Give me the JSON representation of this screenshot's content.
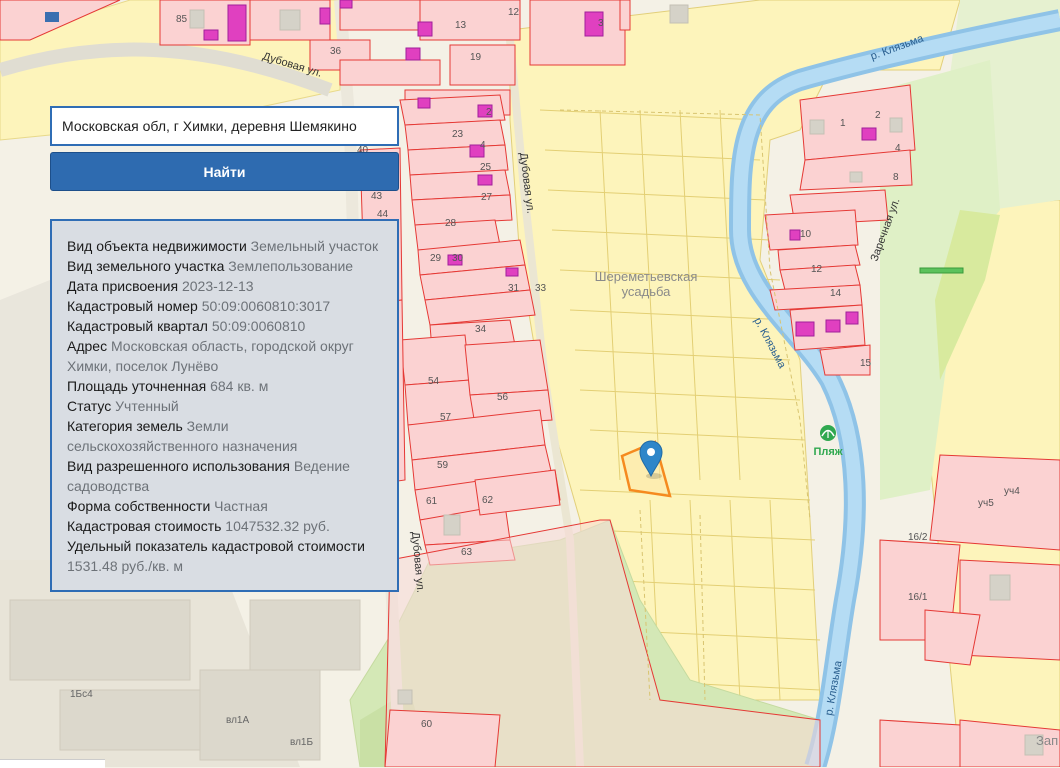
{
  "search": {
    "query": "Московская обл, г Химки, деревня Шемякино",
    "button_label": "Найти"
  },
  "info": {
    "rows": [
      {
        "key": "Вид объекта недвижимости",
        "value": "Земельный участок"
      },
      {
        "key": "Вид земельного участка",
        "value": "Землепользование"
      },
      {
        "key": "Дата присвоения",
        "value": "2023-12-13"
      },
      {
        "key": "Кадастровый номер",
        "value": "50:09:0060810:3017"
      },
      {
        "key": "Кадастровый квартал",
        "value": "50:09:0060810"
      },
      {
        "key": "Адрес",
        "value": "Московская область, городской округ Химки, поселок Лунёво"
      },
      {
        "key": "Площадь уточненная",
        "value": "684 кв. м"
      },
      {
        "key": "Статус",
        "value": "Учтенный"
      },
      {
        "key": "Категория земель",
        "value": "Земли сельскохозяйственного назначения"
      },
      {
        "key": "Вид разрешенного использования",
        "value": "Ведение садоводства"
      },
      {
        "key": "Форма собственности",
        "value": "Частная"
      },
      {
        "key": "Кадастровая стоимость",
        "value": "1047532.32 руб."
      },
      {
        "key": "Удельный показатель кадастровой стоимости",
        "value": "1531.48 руб./кв. м"
      }
    ]
  },
  "map": {
    "streets": {
      "dubovaya_top": "Дубовая ул.",
      "dubovaya_mid": "Дубовая ул.",
      "dubovaya_bottom": "Дубовая ул.",
      "zarechnaya": "Заречная ул."
    },
    "rivers": {
      "top": "р. Клязьма",
      "mid": "р. Клязьма",
      "bottom": "р. Клязьма"
    },
    "area_label_1": "Шереметьевская",
    "area_label_2": "усадьба",
    "beach_label": "Пляж",
    "house_numbers": [
      "85",
      "13",
      "12",
      "3",
      "36",
      "19",
      "2",
      "23",
      "4",
      "40",
      "25",
      "43",
      "27",
      "44",
      "28",
      "29",
      "30",
      "31",
      "33",
      "34",
      "54",
      "56",
      "57",
      "59",
      "61",
      "62",
      "63",
      "60",
      "2",
      "1",
      "4",
      "8",
      "10",
      "12",
      "14",
      "15",
      "16/2",
      "16/1",
      "уч5",
      "уч4"
    ],
    "building_labels": [
      "1Бс4",
      "вл1А",
      "вл1Б"
    ],
    "partial_label": "Зап",
    "colors": {
      "base": "#f4f1e6",
      "yellow_parcel": "#fdf4bb",
      "red_parcel_fill": "#fbd2d2",
      "red_parcel_stroke": "#e53935",
      "green": "#d4e8b6",
      "river": "#a9d3ef",
      "highlight": "#f58a1f",
      "marker": "#2e86c9",
      "magenta": "#e040c0"
    }
  }
}
